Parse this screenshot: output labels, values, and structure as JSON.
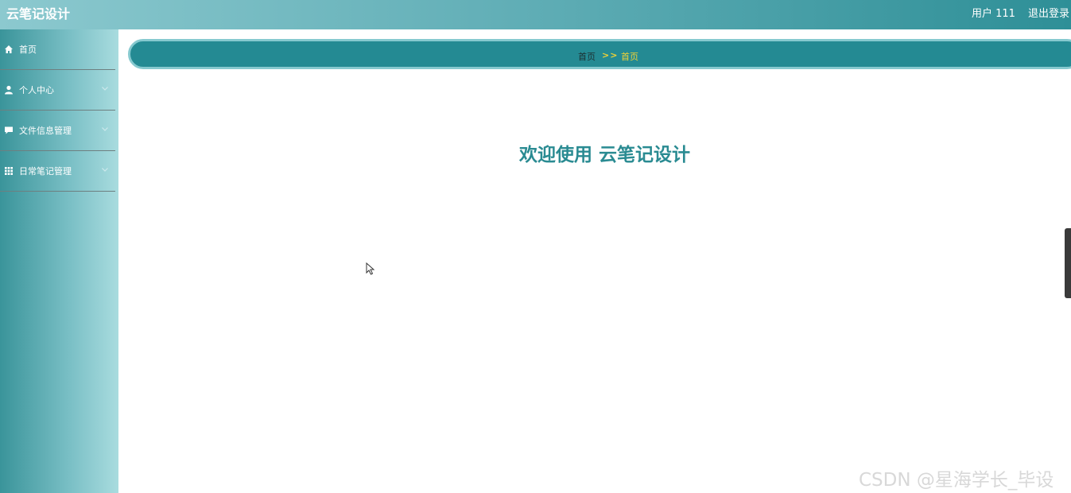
{
  "header": {
    "app_title": "云笔记设计",
    "user_label": "用户 111",
    "logout_label": "退出登录"
  },
  "sidebar": {
    "items": [
      {
        "label": "首页",
        "icon": "home-icon",
        "expandable": false
      },
      {
        "label": "个人中心",
        "icon": "user-icon",
        "expandable": true
      },
      {
        "label": "文件信息管理",
        "icon": "chat-icon",
        "expandable": true
      },
      {
        "label": "日常笔记管理",
        "icon": "grid-icon",
        "expandable": true
      }
    ]
  },
  "breadcrumb": {
    "home": "首页",
    "separator": ">>",
    "current": "首页"
  },
  "main": {
    "welcome": "欢迎使用 云笔记设计"
  },
  "watermark": "CSDN @星海学长_毕设",
  "colors": {
    "accent": "#248a93",
    "breadcrumb_highlight": "#f0d236",
    "welcome_text": "#2a8b92"
  }
}
